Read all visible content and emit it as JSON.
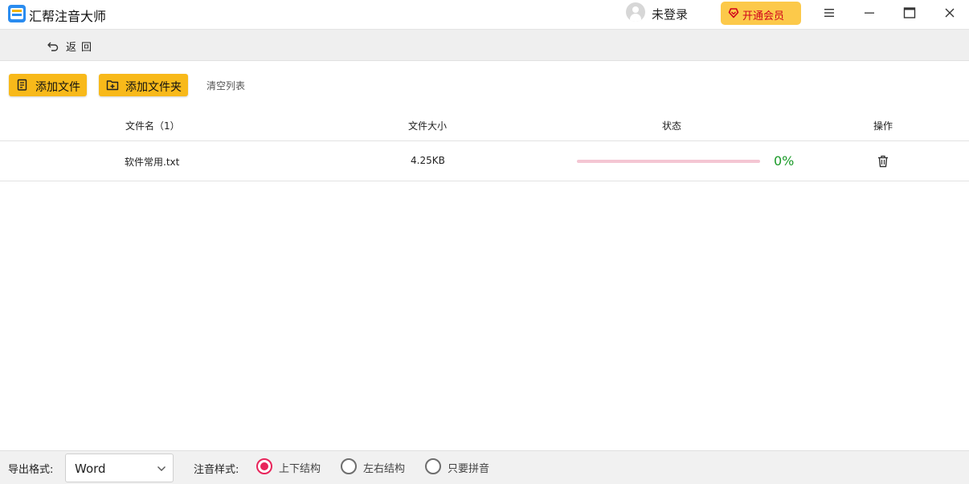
{
  "app": {
    "title": "汇帮注音大师",
    "brand_color": "#2a8cf0"
  },
  "header": {
    "login_text": "未登录",
    "vip_label": "开通会员",
    "vip_color": "#fcc94a"
  },
  "nav": {
    "back_label": "返回"
  },
  "toolbar": {
    "add_file_label": "添加文件",
    "add_folder_label": "添加文件夹",
    "clear_label": "清空列表",
    "button_color": "#f8b91a"
  },
  "table": {
    "headers": {
      "name": "文件名（1）",
      "size": "文件大小",
      "status": "状态",
      "action": "操作"
    },
    "rows": [
      {
        "name": "软件常用.txt",
        "size": "4.25KB",
        "progress": 0,
        "progress_text": "0%"
      }
    ]
  },
  "bottom": {
    "export_label": "导出格式:",
    "format_value": "Word",
    "style_label": "注音样式:",
    "options": [
      {
        "label": "上下结构",
        "checked": true
      },
      {
        "label": "左右结构",
        "checked": false
      },
      {
        "label": "只要拼音",
        "checked": false
      }
    ],
    "accent_color": "#e8245a"
  }
}
